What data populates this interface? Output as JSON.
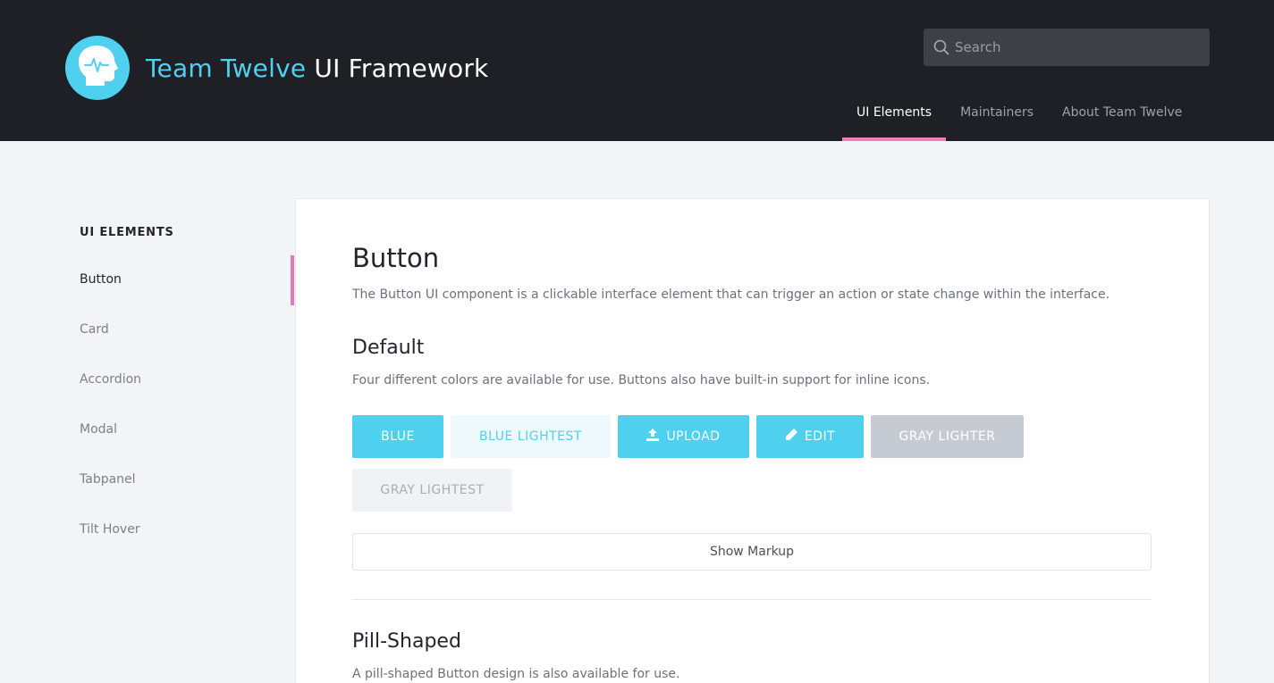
{
  "header": {
    "title_accent": "Team Twelve",
    "title_rest": "UI Framework",
    "search_placeholder": "Search",
    "nav": [
      {
        "label": "UI Elements",
        "active": true
      },
      {
        "label": "Maintainers",
        "active": false
      },
      {
        "label": "About Team Twelve",
        "active": false
      }
    ]
  },
  "sidebar": {
    "heading": "UI ELEMENTS",
    "items": [
      {
        "label": "Button",
        "active": true
      },
      {
        "label": "Card",
        "active": false
      },
      {
        "label": "Accordion",
        "active": false
      },
      {
        "label": "Modal",
        "active": false
      },
      {
        "label": "Tabpanel",
        "active": false
      },
      {
        "label": "Tilt Hover",
        "active": false
      }
    ]
  },
  "main": {
    "title": "Button",
    "description": "The Button UI component is a clickable interface element that can trigger an action or state change within the interface.",
    "default_section": {
      "title": "Default",
      "description": "Four different colors are available for use. Buttons also have built-in support for inline icons.",
      "buttons": [
        {
          "label": "Blue",
          "style": "blue",
          "icon": null
        },
        {
          "label": "Blue Lightest",
          "style": "blue-lightest",
          "icon": null
        },
        {
          "label": "Upload",
          "style": "blue",
          "icon": "upload-icon"
        },
        {
          "label": "Edit",
          "style": "blue",
          "icon": "pencil-icon"
        },
        {
          "label": "Gray Lighter",
          "style": "gray-lighter",
          "icon": null
        },
        {
          "label": "Gray Lightest",
          "style": "gray-lightest",
          "icon": null
        }
      ],
      "show_markup_label": "Show Markup"
    },
    "pill_section": {
      "title": "Pill-Shaped",
      "description": "A pill-shaped Button design is also available for use."
    }
  },
  "colors": {
    "header_bg": "#1e2025",
    "accent_blue": "#4fd0ef",
    "accent_pink": "#ee7eb8",
    "page_bg": "#f3f4f8"
  }
}
